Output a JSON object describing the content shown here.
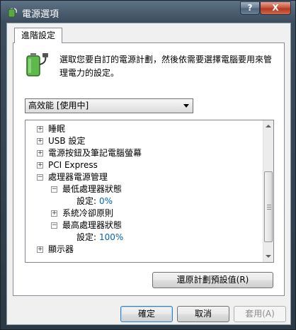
{
  "window": {
    "title": "電源選項"
  },
  "titlebar": {
    "help_label": "?",
    "close_label": "X"
  },
  "tabs": [
    {
      "label": "進階設定"
    }
  ],
  "description": "選取您要自訂的電源計劃，然後依需要選擇電腦要用來管理電力的設定。",
  "plan_select": {
    "value": "高效能 [使用中]"
  },
  "tree": {
    "items": [
      {
        "label": "睡眠",
        "expander": "+"
      },
      {
        "label": "USB 設定",
        "expander": "+"
      },
      {
        "label": "電源按鈕及筆記電腦螢幕",
        "expander": "+"
      },
      {
        "label": "PCI Express",
        "expander": "+"
      },
      {
        "label": "處理器電源管理",
        "expander": "−"
      },
      {
        "label": "最低處理器狀態",
        "expander": "−"
      },
      {
        "label": "設定:",
        "value": "0%"
      },
      {
        "label": "系統冷卻原則",
        "expander": "+"
      },
      {
        "label": "最高處理器狀態",
        "expander": "−"
      },
      {
        "label": "設定:",
        "value": "100%"
      },
      {
        "label": "顯示器",
        "expander": "+"
      }
    ]
  },
  "buttons": {
    "restore": "還原計劃預設值(R)",
    "ok": "確定",
    "cancel": "取消",
    "apply": "套用(A)"
  },
  "colors": {
    "value_text": "#0063b1",
    "title_bar": "#3c4d5e",
    "close_button": "#c9553f"
  }
}
